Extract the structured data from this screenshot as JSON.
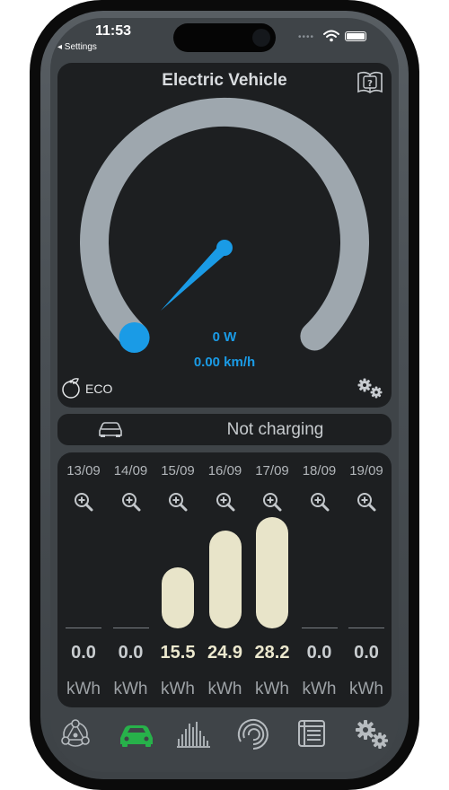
{
  "status_bar": {
    "time": "11:53",
    "back_label": "◂ Settings"
  },
  "gauge": {
    "title": "Electric Vehicle",
    "power": "0 W",
    "speed": "0.00 km/h",
    "mode_label": "ECO",
    "level": 0,
    "track_color": "#9ea7ae",
    "accent_color": "#1a9be6"
  },
  "charging": {
    "status": "Not charging"
  },
  "history": {
    "days": [
      {
        "date": "13/09",
        "value": "0.0",
        "unit": "kWh",
        "kwh": 0.0
      },
      {
        "date": "14/09",
        "value": "0.0",
        "unit": "kWh",
        "kwh": 0.0
      },
      {
        "date": "15/09",
        "value": "15.5",
        "unit": "kWh",
        "kwh": 15.5
      },
      {
        "date": "16/09",
        "value": "24.9",
        "unit": "kWh",
        "kwh": 24.9
      },
      {
        "date": "17/09",
        "value": "28.2",
        "unit": "kWh",
        "kwh": 28.2
      },
      {
        "date": "18/09",
        "value": "0.0",
        "unit": "kWh",
        "kwh": 0.0
      },
      {
        "date": "19/09",
        "value": "0.0",
        "unit": "kWh",
        "kwh": 0.0
      }
    ],
    "bar_color": "#e8e4c9"
  },
  "nav": {
    "items": [
      {
        "icon": "energy-flow-icon",
        "active": false
      },
      {
        "icon": "car-icon",
        "active": true
      },
      {
        "icon": "bar-chart-icon",
        "active": false
      },
      {
        "icon": "spiral-icon",
        "active": false
      },
      {
        "icon": "list-icon",
        "active": false
      },
      {
        "icon": "settings-gears-icon",
        "active": false
      }
    ],
    "active_color": "#27b14a",
    "inactive_color": "#b7bcc0"
  }
}
